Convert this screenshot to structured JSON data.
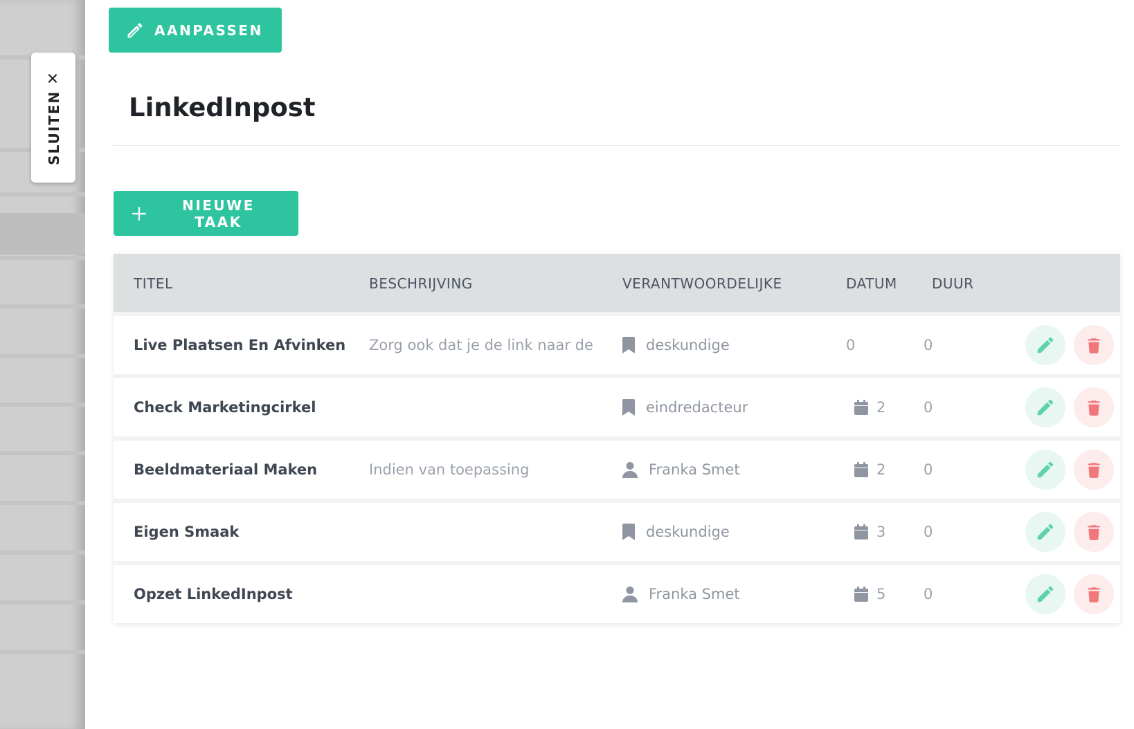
{
  "close_tab": {
    "label": "SLUITEN",
    "icon": "close-icon"
  },
  "toolbar": {
    "edit_label": "AANPASSEN"
  },
  "page": {
    "title": "LinkedInpost"
  },
  "actions": {
    "new_task_label": "NIEUWE TAAK"
  },
  "table": {
    "columns": [
      "TITEL",
      "BESCHRIJVING",
      "VERANTWOORDELIJKE",
      "DATUM",
      "DUUR"
    ],
    "rows": [
      {
        "title": "Live Plaatsen En Afvinken",
        "description": "Zorg ook dat je de link naar de ...",
        "responsible": "deskundige",
        "responsible_icon": "bookmark-icon",
        "date": "0",
        "date_icon": "",
        "duration": "0"
      },
      {
        "title": "Check Marketingcirkel",
        "description": "",
        "responsible": "eindredacteur",
        "responsible_icon": "bookmark-icon",
        "date": "2",
        "date_icon": "calendar-icon",
        "duration": "0"
      },
      {
        "title": "Beeldmateriaal Maken",
        "description": "Indien van toepassing",
        "responsible": "Franka Smet",
        "responsible_icon": "user-icon",
        "date": "2",
        "date_icon": "calendar-icon",
        "duration": "0"
      },
      {
        "title": "Eigen Smaak",
        "description": "",
        "responsible": "deskundige",
        "responsible_icon": "bookmark-icon",
        "date": "3",
        "date_icon": "calendar-icon",
        "duration": "0"
      },
      {
        "title": "Opzet LinkedInpost",
        "description": "",
        "responsible": "Franka Smet",
        "responsible_icon": "user-icon",
        "date": "5",
        "date_icon": "calendar-icon",
        "duration": "0"
      }
    ]
  },
  "colors": {
    "primary": "#2ec4a0",
    "danger": "#f0787a",
    "edit_icon": "#5dd3aa",
    "header_bg": "#dedfe0"
  }
}
